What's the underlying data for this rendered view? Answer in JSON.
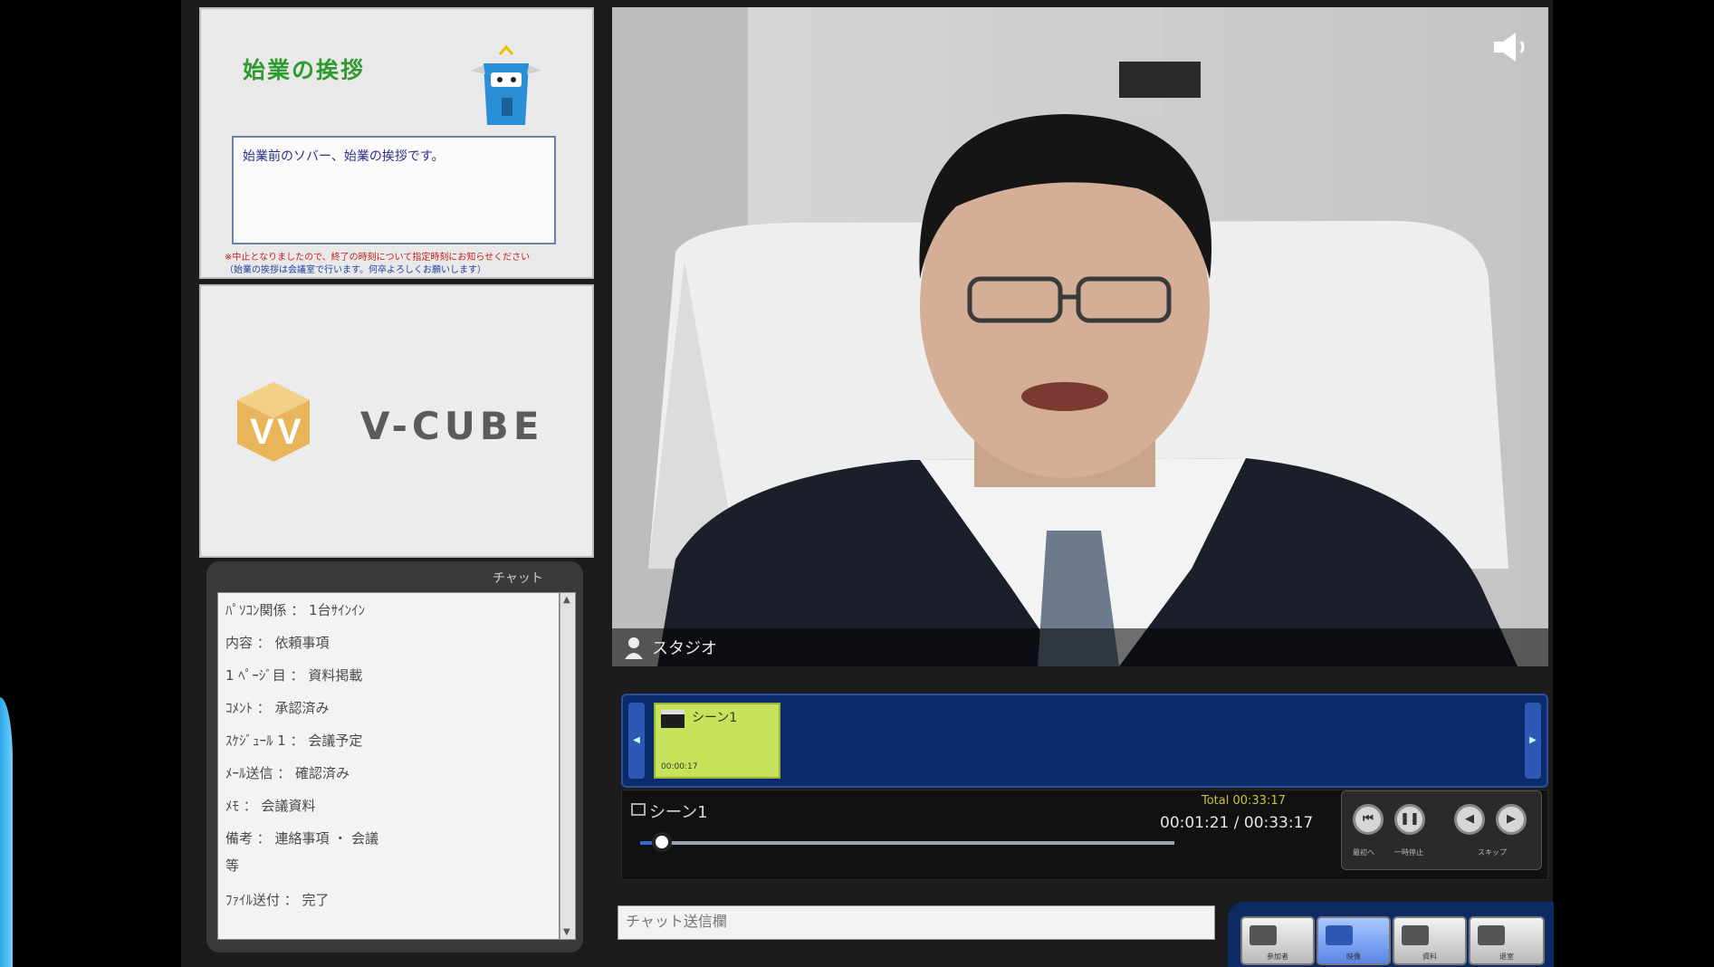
{
  "info_panel": {
    "title": "始業の挨拶",
    "box_text": "始業前のソバー、始業の挨拶です。",
    "note_red": "※中止となりましたので、終了の時刻について指定時刻にお知らせください",
    "note_blue": "（始業の挨拶は会議室で行います。何卒よろしくお願いします）"
  },
  "logo": {
    "text": "V-CUBE"
  },
  "chat": {
    "title": "チャット",
    "lines": [
      "ﾊﾟｿｺﾝ関係 ： 1台ｻｲﾝｲﾝ",
      "内容 ： 依頼事項",
      "1 ﾍﾟｰｼﾞ目 ： 資料掲載",
      "ｺﾒﾝﾄ ： 承認済み",
      "ｽｹｼﾞｭｰﾙ 1 ： 会議予定",
      "ﾒｰﾙ送信 ： 確認済み",
      "ﾒﾓ ： 会議資料",
      "備考 ： 連絡事項 ・ 会議",
      "等",
      "ﾌｧｲﾙ送付 ： 完了"
    ]
  },
  "video": {
    "caption": "スタジオ"
  },
  "scene": {
    "thumb_label": "シーン1",
    "thumb_time": "00:00:17"
  },
  "player": {
    "scene_name": "シーン1",
    "total": "Total 00:33:17",
    "time": "00:01:21 / 00:33:17",
    "progress_percent": 4,
    "buttons": [
      "最初",
      "一時停止",
      "巻戻し",
      "早送り"
    ],
    "btn_labels": [
      "最初へ",
      "一時停止",
      "スキップ"
    ]
  },
  "input": {
    "placeholder": "チャット送信欄"
  },
  "toolbar": {
    "labels": [
      "参加者",
      "映像",
      "資料",
      "退室"
    ]
  },
  "colors": {
    "title_green": "#2f9a2f",
    "strip_blue": "#0b2c6b",
    "thumb_green": "#c8e35a",
    "toolbar_blue": "#0c2a63"
  }
}
